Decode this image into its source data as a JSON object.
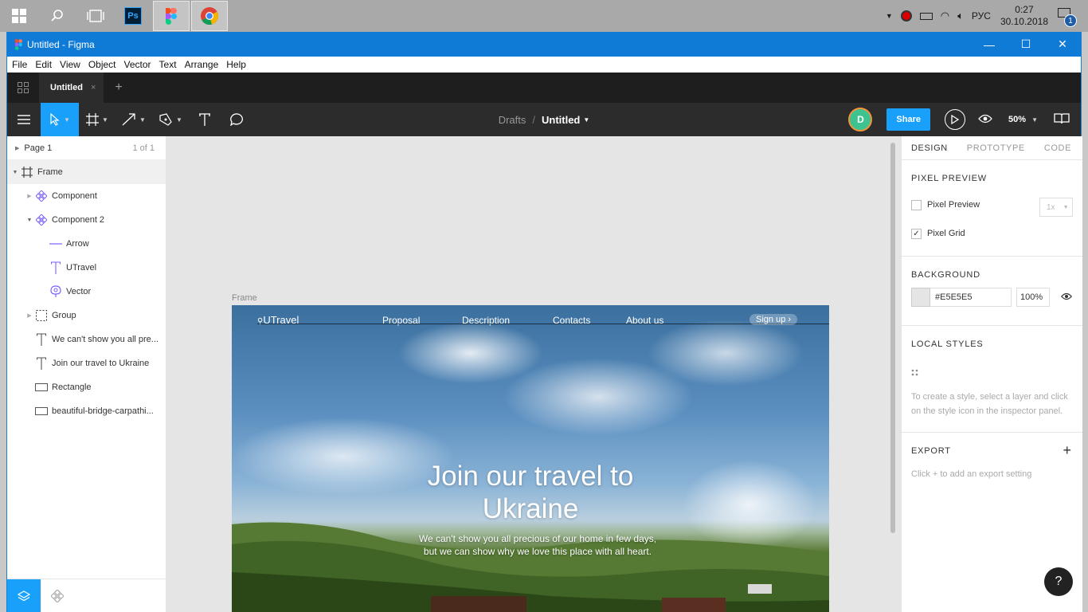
{
  "taskbar": {
    "start_icon": "windows-logo",
    "search_icon": "search",
    "taskview_icon": "task-view",
    "apps": [
      {
        "name": "photoshop",
        "label": "Ps"
      },
      {
        "name": "figma",
        "label": ""
      },
      {
        "name": "chrome",
        "label": ""
      }
    ],
    "tray_lang": "РУС",
    "clock_time": "0:27",
    "clock_date": "30.10.2018",
    "notification_count": "1"
  },
  "window": {
    "title": "Untitled - Figma",
    "controls": {
      "minimize": "—",
      "maximize": "☐",
      "close": "✕"
    }
  },
  "menu": [
    "File",
    "Edit",
    "View",
    "Object",
    "Vector",
    "Text",
    "Arrange",
    "Help"
  ],
  "tabs": {
    "active_label": "Untitled",
    "close": "×",
    "add": "+"
  },
  "toolbar": {
    "breadcrumb_parent": "Drafts",
    "breadcrumb_sep": "/",
    "document_name": "Untitled",
    "user_initial": "D",
    "share_label": "Share",
    "zoom_label": "50%"
  },
  "layers": {
    "page_name": "Page 1",
    "page_count": "1 of 1",
    "items": [
      {
        "label": "Frame",
        "icon": "frame"
      },
      {
        "label": "Component",
        "icon": "component"
      },
      {
        "label": "Component 2",
        "icon": "component"
      },
      {
        "label": "Arrow",
        "icon": "line"
      },
      {
        "label": "UTravel",
        "icon": "text"
      },
      {
        "label": "Vector",
        "icon": "vector"
      },
      {
        "label": "Group",
        "icon": "group"
      },
      {
        "label": "We can't show you all pre...",
        "icon": "text"
      },
      {
        "label": "Join our travel to Ukraine",
        "icon": "text"
      },
      {
        "label": "Rectangle",
        "icon": "rectangle"
      },
      {
        "label": "beautiful-bridge-carpathi...",
        "icon": "image"
      }
    ]
  },
  "canvas": {
    "frame_label": "Frame",
    "nav": {
      "brand": "UTravel",
      "links": [
        "Proposal",
        "Description",
        "Contacts",
        "About us"
      ],
      "signup": "Sign up"
    },
    "heading_line1": "Join our travel to",
    "heading_line2": "Ukraine",
    "sub_line1": "We can't show you all precious of our home in few days,",
    "sub_line2": "but we can show why we love this place with all heart."
  },
  "inspector": {
    "tabs": [
      "DESIGN",
      "PROTOTYPE",
      "CODE"
    ],
    "pixel_preview": {
      "title": "PIXEL PREVIEW",
      "preview_label": "Pixel Preview",
      "grid_label": "Pixel Grid",
      "scale": "1x"
    },
    "background": {
      "title": "BACKGROUND",
      "hex": "#E5E5E5",
      "opacity": "100%"
    },
    "local_styles": {
      "title": "LOCAL STYLES",
      "hint": "To create a style, select a layer and click on the style icon in the inspector panel."
    },
    "export": {
      "title": "EXPORT",
      "add": "+",
      "hint": "Click + to add an export setting"
    },
    "help": "?"
  },
  "colors": {
    "accent": "#18a0fb",
    "titlebar": "#0f7bd7",
    "canvas": "#e5e5e5",
    "toolbar": "#2c2c2c"
  }
}
